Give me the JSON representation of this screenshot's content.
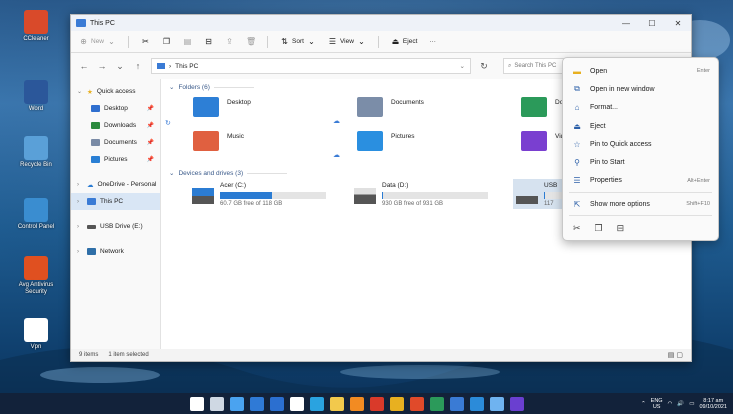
{
  "window": {
    "title": "This PC",
    "controls": {
      "minimize": "—",
      "maximize": "☐",
      "close": "✕"
    }
  },
  "toolbar": {
    "new_label": "New",
    "sort_label": "Sort",
    "view_label": "View",
    "eject_label": "Eject",
    "more_label": "···"
  },
  "address": {
    "path": "This PC",
    "search_placeholder": "Search This PC"
  },
  "nav": {
    "quick_access": "Quick access",
    "quick_items": [
      {
        "label": "Desktop",
        "color": "#2f6fcf"
      },
      {
        "label": "Downloads",
        "color": "#2b8a3e"
      },
      {
        "label": "Documents",
        "color": "#7a8ba6"
      },
      {
        "label": "Pictures",
        "color": "#2a7fd4"
      }
    ],
    "onedrive": "OneDrive - Personal",
    "this_pc": "This PC",
    "usb": "USB Drive (E:)",
    "network": "Network"
  },
  "content": {
    "folders_header": "Folders (6)",
    "drives_header": "Devices and drives (3)",
    "folders": [
      {
        "name": "Desktop",
        "color": "#2d7fd6"
      },
      {
        "name": "Documents",
        "color": "#7b8da8"
      },
      {
        "name": "Dow",
        "color": "#2b9a5a"
      },
      {
        "name": "Music",
        "color": "#e06040"
      },
      {
        "name": "Pictures",
        "color": "#2a8fe0"
      },
      {
        "name": "Vide",
        "color": "#7a3fd0"
      }
    ],
    "drives": [
      {
        "name": "Acer (C:)",
        "free": "60.7 GB free of 118 GB",
        "used_fraction": 0.49
      },
      {
        "name": "Data (D:)",
        "free": "930 GB free of 931 GB",
        "used_fraction": 0.001
      },
      {
        "name": "USB",
        "free": "117",
        "used_fraction": 0.01
      }
    ]
  },
  "status": {
    "items": "9 items",
    "selected": "1 item selected"
  },
  "context_menu": {
    "items": [
      {
        "label": "Open",
        "shortcut": "Enter",
        "icon": "folder-open-icon"
      },
      {
        "label": "Open in new window",
        "shortcut": "",
        "icon": "new-window-icon"
      },
      {
        "label": "Format...",
        "shortcut": "",
        "icon": "format-icon"
      },
      {
        "label": "Eject",
        "shortcut": "",
        "icon": "eject-icon"
      },
      {
        "label": "Pin to Quick access",
        "shortcut": "",
        "icon": "star-icon"
      },
      {
        "label": "Pin to Start",
        "shortcut": "",
        "icon": "pin-icon"
      },
      {
        "label": "Properties",
        "shortcut": "Alt+Enter",
        "icon": "properties-icon"
      }
    ],
    "more": {
      "label": "Show more options",
      "shortcut": "Shift+F10"
    }
  },
  "desktop": {
    "icons": [
      {
        "label": "CCleaner",
        "color": "#d94a2a"
      },
      {
        "label": "Word",
        "color": "#2b579a"
      },
      {
        "label": "Recycle Bin",
        "color": "#5aa0d8"
      },
      {
        "label": "Control Panel",
        "color": "#3a8dd0"
      },
      {
        "label": "Avg Antivirus Security",
        "color": "#e05020"
      },
      {
        "label": "Vpn",
        "color": "#ffffff"
      }
    ]
  },
  "taskbar": {
    "apps": [
      "#ffffff",
      "#cfd8e3",
      "#4aa3f0",
      "#2f7ad6",
      "#2b6fd0",
      "#ffffff",
      "#2aa3e0",
      "#f2c94c",
      "#f28b22",
      "#d93a2a",
      "#e8b020",
      "#e04a2a",
      "#2b9a5a",
      "#3a7bd5",
      "#2b8bd9",
      "#6fb3f0",
      "#6a3fd0"
    ],
    "lang_top": "ENG",
    "lang_bottom": "US",
    "time": "8:17 am",
    "date": "09/10/2021"
  },
  "colors": {
    "accent": "#2b7cd3",
    "selection": "#d6e2ef",
    "taskbar": "#12223a"
  }
}
